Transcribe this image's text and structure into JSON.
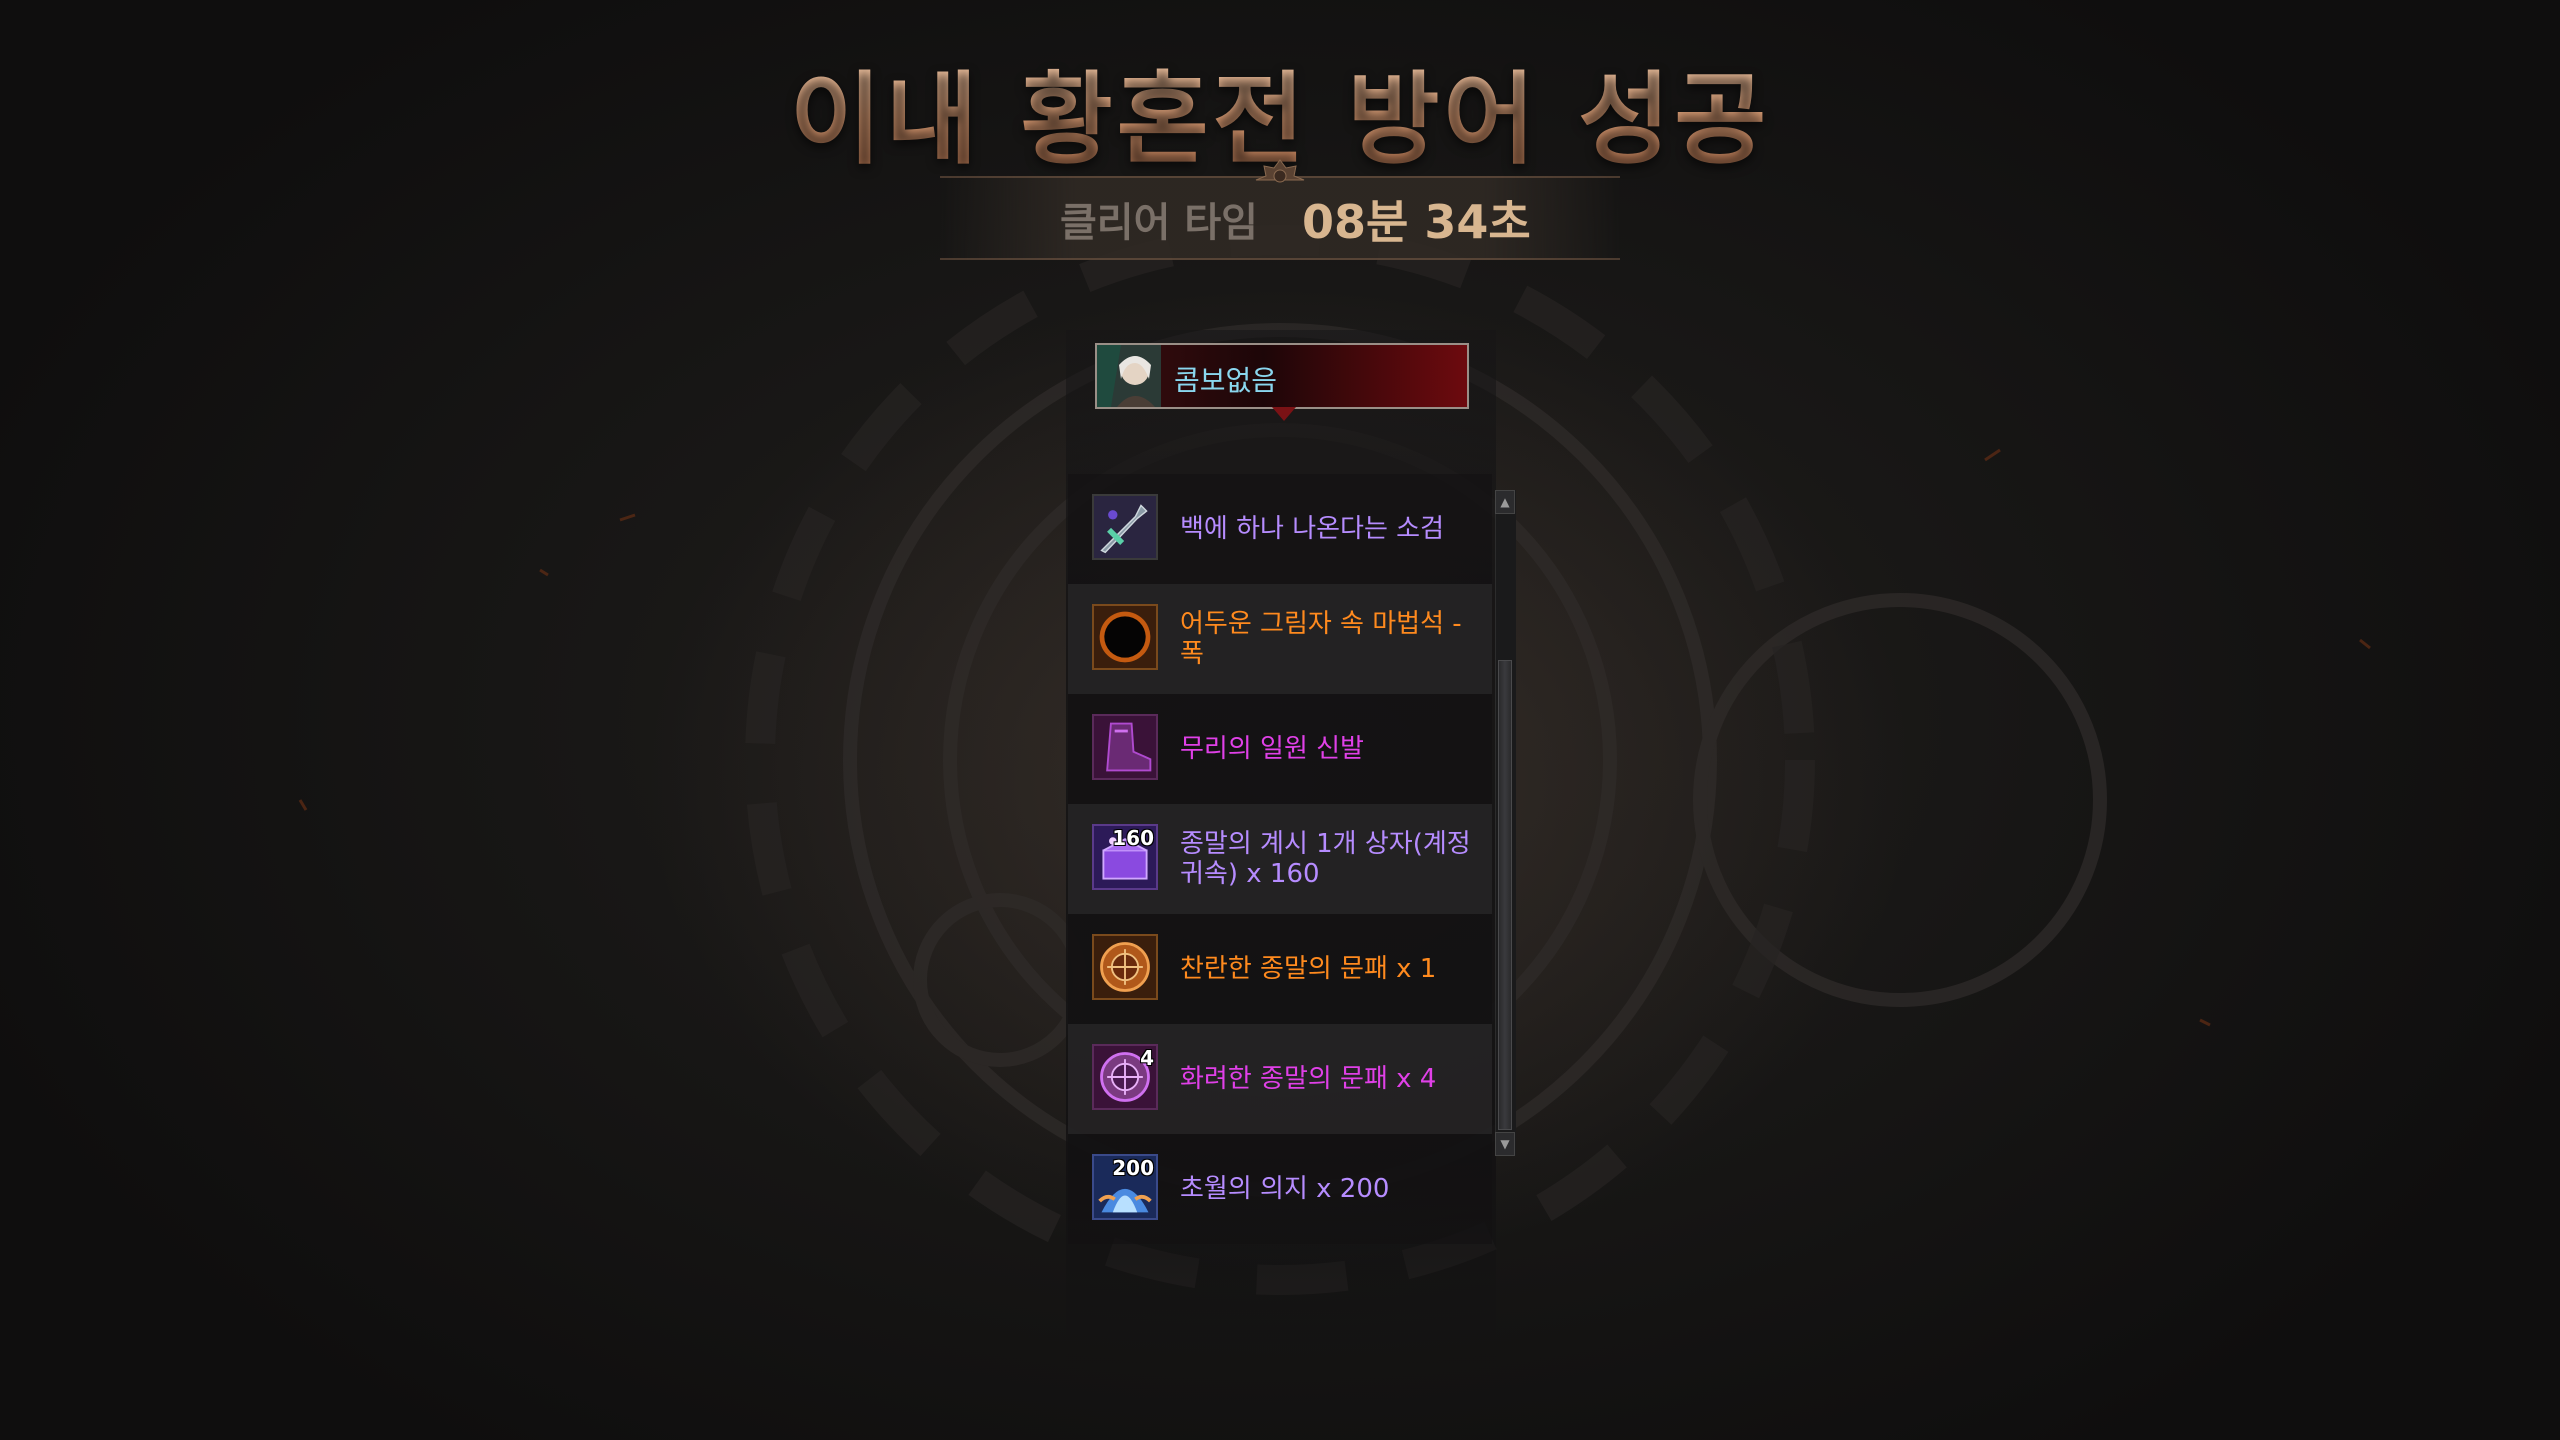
{
  "title": "이내 황혼전 방어 성공",
  "clear_time": {
    "label": "클리어 타임",
    "value": "08분 34초"
  },
  "player": {
    "name": "콤보없음",
    "portrait_icon": "character-portrait-icon",
    "box_color": "#6d0a0e",
    "name_color": "#8ad7ef"
  },
  "rewards": [
    {
      "name": "백에 하나 나온다는 소검",
      "icon": "dagger-icon",
      "color": "#b68cff",
      "badge": ""
    },
    {
      "name": "어두운 그림자 속 마법석 - 폭",
      "icon": "dark-orb-icon",
      "color": "#ff8a1e",
      "badge": ""
    },
    {
      "name": "무리의 일원 신발",
      "icon": "boots-icon",
      "color": "#e040e8",
      "badge": ""
    },
    {
      "name": "종말의 계시 1개 상자(계정귀속) x 160",
      "icon": "box-icon",
      "color": "#b68cff",
      "badge": "160"
    },
    {
      "name": "찬란한 종말의 문패 x 1",
      "icon": "orange-emblem-icon",
      "color": "#ff8a1e",
      "badge": ""
    },
    {
      "name": "화려한 종말의 문패 x 4",
      "icon": "purple-emblem-icon",
      "color": "#e040e8",
      "badge": "4"
    },
    {
      "name": "초월의 의지 x 200",
      "icon": "will-icon",
      "color": "#b68cff",
      "badge": "200"
    }
  ],
  "colors": {
    "title_gradient_top": "#f5d3b4",
    "title_gradient_bottom": "#a86a48",
    "clear_label": "#7a7068",
    "clear_value": "#d8b690",
    "legendary": "#ff8a1e",
    "epic_pink": "#e040e8",
    "unique_purple": "#b68cff"
  }
}
